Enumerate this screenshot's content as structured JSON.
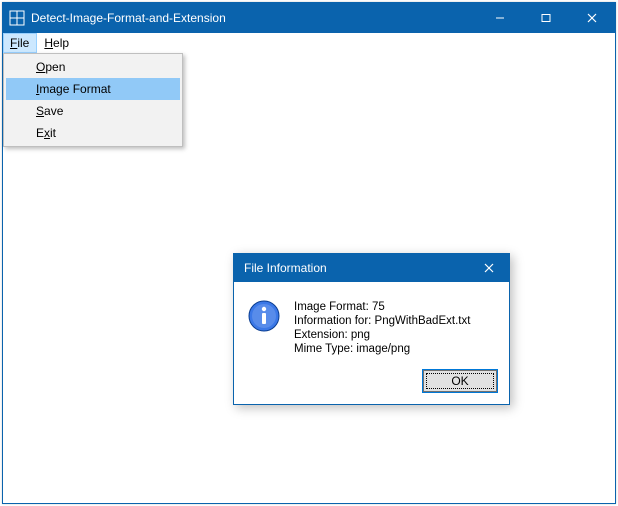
{
  "window": {
    "title": "Detect-Image-Format-and-Extension"
  },
  "menubar": {
    "file": {
      "label": "File",
      "mnemonic": "F",
      "rest": "ile"
    },
    "help": {
      "label": "Help",
      "mnemonic": "H",
      "rest": "elp"
    }
  },
  "file_menu": {
    "open": {
      "mnemonic": "O",
      "rest": "pen"
    },
    "image_format": {
      "mnemonic": "I",
      "rest": "mage Format"
    },
    "save": {
      "mnemonic": "S",
      "rest": "ave"
    },
    "exit": {
      "mnemonic": "E",
      "rest_pre": "",
      "mnemonic_char": "x",
      "rest": "it",
      "prefix": "E"
    }
  },
  "dialog": {
    "title": "File Information",
    "lines": {
      "l1": "Image Format: 75",
      "l2": "Information for: PngWithBadExt.txt",
      "l3": "Extension: png",
      "l4": "Mime Type: image/png"
    },
    "ok": "OK"
  }
}
